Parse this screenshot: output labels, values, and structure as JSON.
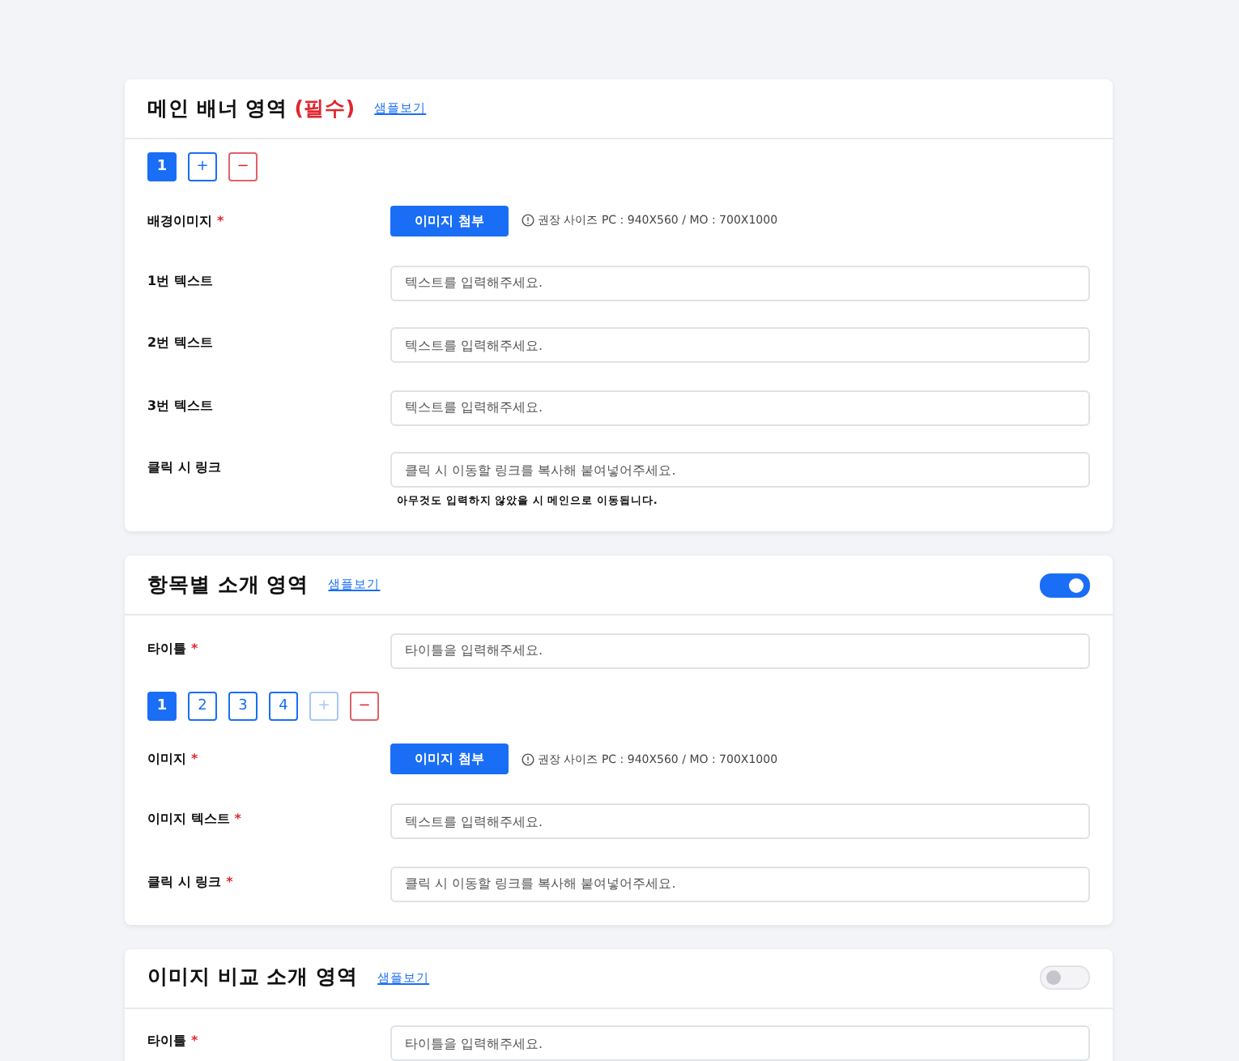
{
  "sections": [
    {
      "title": "메인 배너 영역",
      "title_note": "(필수)",
      "sample_link": "샘플보기",
      "rows": [
        {
          "kind": "pager",
          "items": [
            {
              "kind": "number",
              "label": "1",
              "selected": true
            },
            {
              "kind": "add",
              "label": "+",
              "disabled": false
            },
            {
              "kind": "remove",
              "label": "−"
            }
          ]
        },
        {
          "kind": "file",
          "label": "배경이미지",
          "required_mark": "*",
          "button": "이미지 첨부",
          "hint": "권장 사이즈 PC : 940X560 / MO : 700X1000"
        },
        {
          "kind": "text",
          "label": "1번 텍스트",
          "placeholder": "텍스트를 입력해주세요."
        },
        {
          "kind": "text",
          "label": "2번 텍스트",
          "placeholder": "텍스트를 입력해주세요."
        },
        {
          "kind": "text",
          "label": "3번 텍스트",
          "placeholder": "텍스트를 입력해주세요."
        },
        {
          "kind": "text",
          "label": "클릭 시 링크",
          "placeholder": "클릭 시 이동할 링크를 복사해 붙여넣어주세요.",
          "note": "아무것도 입력하지 않았을 시 메인으로 이동됩니다."
        }
      ]
    },
    {
      "title": "항목별 소개 영역",
      "sample_link": "샘플보기",
      "toggle": {
        "on": true
      },
      "rows": [
        {
          "kind": "text",
          "label": "타이틀",
          "required_mark": "*",
          "placeholder": "타이틀을 입력해주세요."
        },
        {
          "kind": "pager",
          "items": [
            {
              "kind": "number",
              "label": "1",
              "selected": true
            },
            {
              "kind": "number",
              "label": "2",
              "selected": false
            },
            {
              "kind": "number",
              "label": "3",
              "selected": false
            },
            {
              "kind": "number",
              "label": "4",
              "selected": false
            },
            {
              "kind": "add",
              "label": "+",
              "disabled": true
            },
            {
              "kind": "remove",
              "label": "−"
            }
          ]
        },
        {
          "kind": "file",
          "label": "이미지",
          "required_mark": "*",
          "button": "이미지 첨부",
          "hint": "권장 사이즈 PC : 940X560 / MO : 700X1000"
        },
        {
          "kind": "text",
          "label": "이미지 텍스트",
          "required_mark": "*",
          "placeholder": "텍스트를 입력해주세요."
        },
        {
          "kind": "text",
          "label": "클릭 시 링크",
          "required_mark": "*",
          "placeholder": "클릭 시 이동할 링크를 복사해 붙여넣어주세요."
        }
      ]
    },
    {
      "title": "이미지 비교 소개 영역",
      "sample_link": "샘플보기",
      "toggle": {
        "on": false
      },
      "rows": [
        {
          "kind": "text",
          "label": "타이틀",
          "required_mark": "*",
          "placeholder": "타이틀을 입력해주세요."
        }
      ]
    }
  ]
}
